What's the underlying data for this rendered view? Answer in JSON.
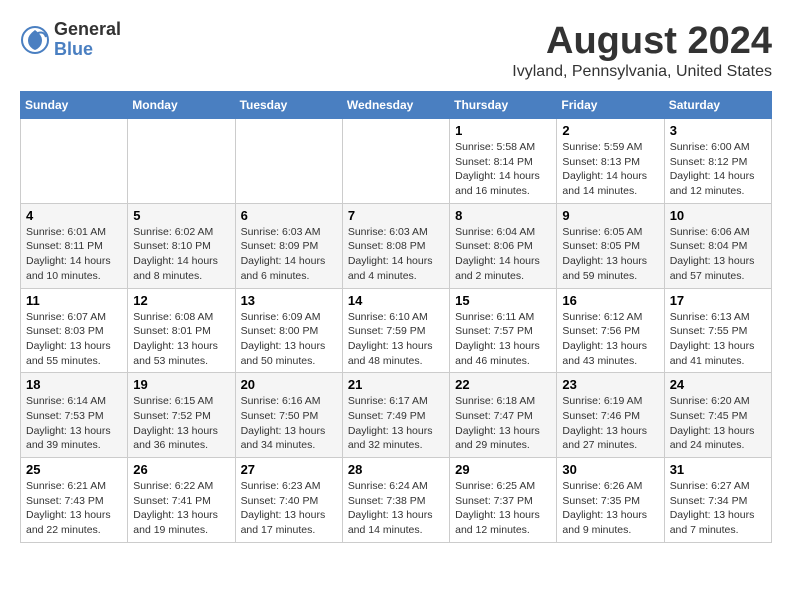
{
  "logo": {
    "general": "General",
    "blue": "Blue"
  },
  "title": "August 2024",
  "subtitle": "Ivyland, Pennsylvania, United States",
  "days_of_week": [
    "Sunday",
    "Monday",
    "Tuesday",
    "Wednesday",
    "Thursday",
    "Friday",
    "Saturday"
  ],
  "weeks": [
    [
      {
        "day": "",
        "info": ""
      },
      {
        "day": "",
        "info": ""
      },
      {
        "day": "",
        "info": ""
      },
      {
        "day": "",
        "info": ""
      },
      {
        "day": "1",
        "info": "Sunrise: 5:58 AM\nSunset: 8:14 PM\nDaylight: 14 hours\nand 16 minutes."
      },
      {
        "day": "2",
        "info": "Sunrise: 5:59 AM\nSunset: 8:13 PM\nDaylight: 14 hours\nand 14 minutes."
      },
      {
        "day": "3",
        "info": "Sunrise: 6:00 AM\nSunset: 8:12 PM\nDaylight: 14 hours\nand 12 minutes."
      }
    ],
    [
      {
        "day": "4",
        "info": "Sunrise: 6:01 AM\nSunset: 8:11 PM\nDaylight: 14 hours\nand 10 minutes."
      },
      {
        "day": "5",
        "info": "Sunrise: 6:02 AM\nSunset: 8:10 PM\nDaylight: 14 hours\nand 8 minutes."
      },
      {
        "day": "6",
        "info": "Sunrise: 6:03 AM\nSunset: 8:09 PM\nDaylight: 14 hours\nand 6 minutes."
      },
      {
        "day": "7",
        "info": "Sunrise: 6:03 AM\nSunset: 8:08 PM\nDaylight: 14 hours\nand 4 minutes."
      },
      {
        "day": "8",
        "info": "Sunrise: 6:04 AM\nSunset: 8:06 PM\nDaylight: 14 hours\nand 2 minutes."
      },
      {
        "day": "9",
        "info": "Sunrise: 6:05 AM\nSunset: 8:05 PM\nDaylight: 13 hours\nand 59 minutes."
      },
      {
        "day": "10",
        "info": "Sunrise: 6:06 AM\nSunset: 8:04 PM\nDaylight: 13 hours\nand 57 minutes."
      }
    ],
    [
      {
        "day": "11",
        "info": "Sunrise: 6:07 AM\nSunset: 8:03 PM\nDaylight: 13 hours\nand 55 minutes."
      },
      {
        "day": "12",
        "info": "Sunrise: 6:08 AM\nSunset: 8:01 PM\nDaylight: 13 hours\nand 53 minutes."
      },
      {
        "day": "13",
        "info": "Sunrise: 6:09 AM\nSunset: 8:00 PM\nDaylight: 13 hours\nand 50 minutes."
      },
      {
        "day": "14",
        "info": "Sunrise: 6:10 AM\nSunset: 7:59 PM\nDaylight: 13 hours\nand 48 minutes."
      },
      {
        "day": "15",
        "info": "Sunrise: 6:11 AM\nSunset: 7:57 PM\nDaylight: 13 hours\nand 46 minutes."
      },
      {
        "day": "16",
        "info": "Sunrise: 6:12 AM\nSunset: 7:56 PM\nDaylight: 13 hours\nand 43 minutes."
      },
      {
        "day": "17",
        "info": "Sunrise: 6:13 AM\nSunset: 7:55 PM\nDaylight: 13 hours\nand 41 minutes."
      }
    ],
    [
      {
        "day": "18",
        "info": "Sunrise: 6:14 AM\nSunset: 7:53 PM\nDaylight: 13 hours\nand 39 minutes."
      },
      {
        "day": "19",
        "info": "Sunrise: 6:15 AM\nSunset: 7:52 PM\nDaylight: 13 hours\nand 36 minutes."
      },
      {
        "day": "20",
        "info": "Sunrise: 6:16 AM\nSunset: 7:50 PM\nDaylight: 13 hours\nand 34 minutes."
      },
      {
        "day": "21",
        "info": "Sunrise: 6:17 AM\nSunset: 7:49 PM\nDaylight: 13 hours\nand 32 minutes."
      },
      {
        "day": "22",
        "info": "Sunrise: 6:18 AM\nSunset: 7:47 PM\nDaylight: 13 hours\nand 29 minutes."
      },
      {
        "day": "23",
        "info": "Sunrise: 6:19 AM\nSunset: 7:46 PM\nDaylight: 13 hours\nand 27 minutes."
      },
      {
        "day": "24",
        "info": "Sunrise: 6:20 AM\nSunset: 7:45 PM\nDaylight: 13 hours\nand 24 minutes."
      }
    ],
    [
      {
        "day": "25",
        "info": "Sunrise: 6:21 AM\nSunset: 7:43 PM\nDaylight: 13 hours\nand 22 minutes."
      },
      {
        "day": "26",
        "info": "Sunrise: 6:22 AM\nSunset: 7:41 PM\nDaylight: 13 hours\nand 19 minutes."
      },
      {
        "day": "27",
        "info": "Sunrise: 6:23 AM\nSunset: 7:40 PM\nDaylight: 13 hours\nand 17 minutes."
      },
      {
        "day": "28",
        "info": "Sunrise: 6:24 AM\nSunset: 7:38 PM\nDaylight: 13 hours\nand 14 minutes."
      },
      {
        "day": "29",
        "info": "Sunrise: 6:25 AM\nSunset: 7:37 PM\nDaylight: 13 hours\nand 12 minutes."
      },
      {
        "day": "30",
        "info": "Sunrise: 6:26 AM\nSunset: 7:35 PM\nDaylight: 13 hours\nand 9 minutes."
      },
      {
        "day": "31",
        "info": "Sunrise: 6:27 AM\nSunset: 7:34 PM\nDaylight: 13 hours\nand 7 minutes."
      }
    ]
  ]
}
